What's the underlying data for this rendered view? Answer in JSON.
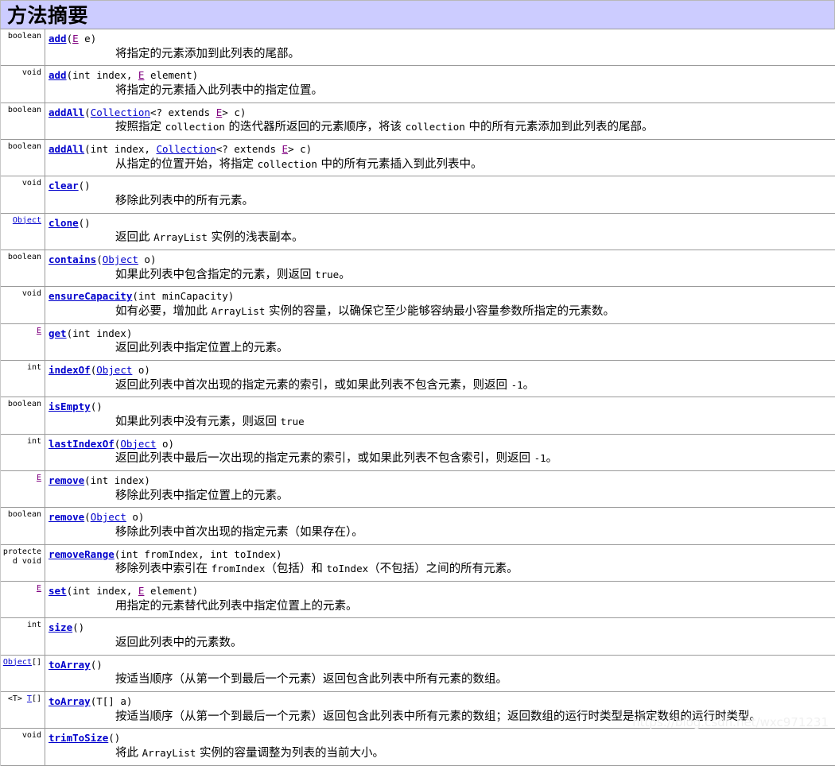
{
  "header": {
    "title": "方法摘要",
    "bg_color": "#ccccff",
    "border_color": "#9a9a9a"
  },
  "colors": {
    "link": "#0000cc",
    "visited_link": "#800080",
    "text": "#000000",
    "row_border": "#9a9a9a",
    "watermark": "#f0f0f0"
  },
  "watermark": {
    "text": "https://blog.csdn.net/wxc971231"
  },
  "table": {
    "rows": [
      {
        "return_type": "boolean",
        "return_type_link": false,
        "method": "add",
        "signature_parts": [
          {
            "text": "(",
            "style": "plain"
          },
          {
            "text": "E",
            "style": "visited-link"
          },
          {
            "text": " e)",
            "style": "plain"
          }
        ],
        "description": "将指定的元素添加到此列表的尾部。"
      },
      {
        "return_type": "void",
        "return_type_link": false,
        "method": "add",
        "signature_parts": [
          {
            "text": "(int index, ",
            "style": "plain"
          },
          {
            "text": "E",
            "style": "visited-link"
          },
          {
            "text": " element)",
            "style": "plain"
          }
        ],
        "description": "将指定的元素插入此列表中的指定位置。"
      },
      {
        "return_type": "boolean",
        "return_type_link": false,
        "method": "addAll",
        "signature_parts": [
          {
            "text": "(",
            "style": "plain"
          },
          {
            "text": "Collection",
            "style": "link"
          },
          {
            "text": "<? extends ",
            "style": "plain"
          },
          {
            "text": "E",
            "style": "visited-link"
          },
          {
            "text": "> c)",
            "style": "plain"
          }
        ],
        "description": "按照指定 collection 的迭代器所返回的元素顺序，将该 collection 中的所有元素添加到此列表的尾部。"
      },
      {
        "return_type": "boolean",
        "return_type_link": false,
        "method": "addAll",
        "signature_parts": [
          {
            "text": "(int index, ",
            "style": "plain"
          },
          {
            "text": "Collection",
            "style": "link"
          },
          {
            "text": "<? extends ",
            "style": "plain"
          },
          {
            "text": "E",
            "style": "visited-link"
          },
          {
            "text": "> c)",
            "style": "plain"
          }
        ],
        "description": "从指定的位置开始，将指定 collection 中的所有元素插入到此列表中。"
      },
      {
        "return_type": "void",
        "return_type_link": false,
        "method": "clear",
        "signature_parts": [
          {
            "text": "()",
            "style": "plain"
          }
        ],
        "description": "移除此列表中的所有元素。"
      },
      {
        "return_type": "Object",
        "return_type_link": true,
        "method": "clone",
        "signature_parts": [
          {
            "text": "()",
            "style": "plain"
          }
        ],
        "description": "返回此 ArrayList 实例的浅表副本。"
      },
      {
        "return_type": "boolean",
        "return_type_link": false,
        "method": "contains",
        "signature_parts": [
          {
            "text": "(",
            "style": "plain"
          },
          {
            "text": "Object",
            "style": "link"
          },
          {
            "text": " o)",
            "style": "plain"
          }
        ],
        "description": "如果此列表中包含指定的元素，则返回 true。"
      },
      {
        "return_type": "void",
        "return_type_link": false,
        "method": "ensureCapacity",
        "signature_parts": [
          {
            "text": "(int minCapacity)",
            "style": "plain"
          }
        ],
        "description": "如有必要，增加此 ArrayList 实例的容量，以确保它至少能够容纳最小容量参数所指定的元素数。"
      },
      {
        "return_type": "E",
        "return_type_link": "visited",
        "method": "get",
        "signature_parts": [
          {
            "text": "(int index)",
            "style": "plain"
          }
        ],
        "description": "返回此列表中指定位置上的元素。"
      },
      {
        "return_type": "int",
        "return_type_link": false,
        "method": "indexOf",
        "signature_parts": [
          {
            "text": "(",
            "style": "plain"
          },
          {
            "text": "Object",
            "style": "link"
          },
          {
            "text": " o)",
            "style": "plain"
          }
        ],
        "description": "返回此列表中首次出现的指定元素的索引，或如果此列表不包含元素，则返回 -1。"
      },
      {
        "return_type": "boolean",
        "return_type_link": false,
        "method": "isEmpty",
        "signature_parts": [
          {
            "text": "()",
            "style": "plain"
          }
        ],
        "description": "如果此列表中没有元素，则返回 true"
      },
      {
        "return_type": "int",
        "return_type_link": false,
        "method": "lastIndexOf",
        "signature_parts": [
          {
            "text": "(",
            "style": "plain"
          },
          {
            "text": "Object",
            "style": "link"
          },
          {
            "text": " o)",
            "style": "plain"
          }
        ],
        "description": "返回此列表中最后一次出现的指定元素的索引，或如果此列表不包含索引，则返回 -1。"
      },
      {
        "return_type": "E",
        "return_type_link": "visited",
        "method": "remove",
        "signature_parts": [
          {
            "text": "(int index)",
            "style": "plain"
          }
        ],
        "description": "移除此列表中指定位置上的元素。"
      },
      {
        "return_type": "boolean",
        "return_type_link": false,
        "method": "remove",
        "signature_parts": [
          {
            "text": "(",
            "style": "plain"
          },
          {
            "text": "Object",
            "style": "link"
          },
          {
            "text": " o)",
            "style": "plain"
          }
        ],
        "description": "移除此列表中首次出现的指定元素（如果存在）。"
      },
      {
        "return_type": "protected void",
        "return_type_link": false,
        "method": "removeRange",
        "signature_parts": [
          {
            "text": "(int fromIndex, int toIndex)",
            "style": "plain"
          }
        ],
        "description": "移除列表中索引在 fromIndex（包括）和 toIndex（不包括）之间的所有元素。"
      },
      {
        "return_type": "E",
        "return_type_link": "visited",
        "method": "set",
        "signature_parts": [
          {
            "text": "(int index, ",
            "style": "plain"
          },
          {
            "text": "E",
            "style": "visited-link"
          },
          {
            "text": " element)",
            "style": "plain"
          }
        ],
        "description": "用指定的元素替代此列表中指定位置上的元素。"
      },
      {
        "return_type": "int",
        "return_type_link": false,
        "method": "size",
        "signature_parts": [
          {
            "text": "()",
            "style": "plain"
          }
        ],
        "description": "返回此列表中的元素数。"
      },
      {
        "return_type": "Object[]",
        "return_type_link": "object-array",
        "method": "toArray",
        "signature_parts": [
          {
            "text": "()",
            "style": "plain"
          }
        ],
        "description": "按适当顺序（从第一个到最后一个元素）返回包含此列表中所有元素的数组。"
      },
      {
        "return_type": "<T> T[]",
        "return_type_link": "generic-array",
        "method": "toArray",
        "signature_parts": [
          {
            "text": "(T[] a)",
            "style": "plain"
          }
        ],
        "description": "按适当顺序（从第一个到最后一个元素）返回包含此列表中所有元素的数组；返回数组的运行时类型是指定数组的运行时类型。"
      },
      {
        "return_type": "void",
        "return_type_link": false,
        "method": "trimToSize",
        "signature_parts": [
          {
            "text": "()",
            "style": "plain"
          }
        ],
        "description": "将此 ArrayList 实例的容量调整为列表的当前大小。"
      }
    ]
  }
}
